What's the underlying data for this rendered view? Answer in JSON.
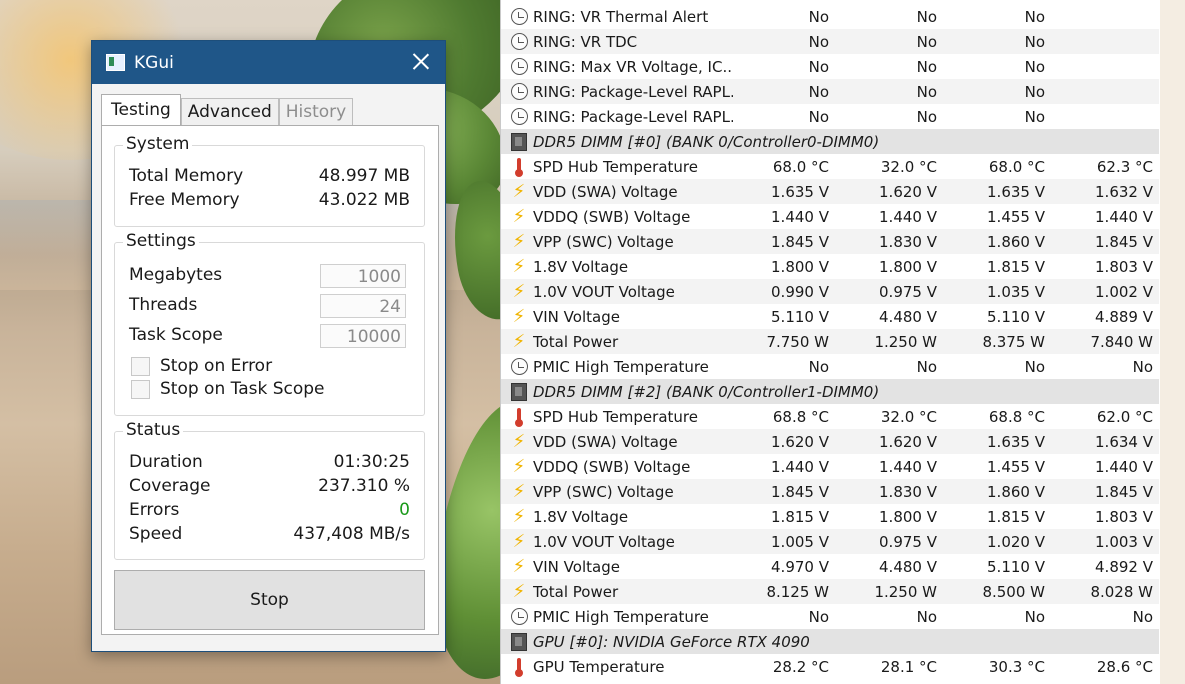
{
  "window": {
    "title": "KGui",
    "icons": {
      "app": "app-icon",
      "close": "close-icon"
    }
  },
  "tabs": [
    {
      "label": "Testing",
      "state": "active"
    },
    {
      "label": "Advanced",
      "state": "normal"
    },
    {
      "label": "History",
      "state": "disabled"
    }
  ],
  "system": {
    "title": "System",
    "total_memory_label": "Total Memory",
    "total_memory_value": "48.997 MB",
    "free_memory_label": "Free Memory",
    "free_memory_value": "43.022 MB"
  },
  "settings": {
    "title": "Settings",
    "megabytes_label": "Megabytes",
    "megabytes_value": "1000",
    "threads_label": "Threads",
    "threads_value": "24",
    "task_scope_label": "Task Scope",
    "task_scope_value": "10000",
    "stop_on_error_label": "Stop on Error",
    "stop_on_task_scope_label": "Stop on Task Scope"
  },
  "status": {
    "title": "Status",
    "duration_label": "Duration",
    "duration_value": "01:30:25",
    "coverage_label": "Coverage",
    "coverage_value": "237.310 %",
    "errors_label": "Errors",
    "errors_value": "0",
    "speed_label": "Speed",
    "speed_value": "437,408 MB/s"
  },
  "stop_button": {
    "label": "Stop"
  },
  "colors": {
    "titlebar": "#1f5688",
    "errors_ok": "#1a9a1a",
    "bolt": "#f0b400",
    "thermometer": "#d23d2d"
  },
  "sensors": {
    "rows": [
      {
        "kind": "clock",
        "name": "RING: VR Thermal Alert",
        "c1": "No",
        "c2": "No",
        "c3": "No",
        "c4": ""
      },
      {
        "kind": "clock",
        "name": "RING: VR TDC",
        "c1": "No",
        "c2": "No",
        "c3": "No",
        "c4": ""
      },
      {
        "kind": "clock",
        "name": "RING: Max VR Voltage, IC...",
        "c1": "No",
        "c2": "No",
        "c3": "No",
        "c4": ""
      },
      {
        "kind": "clock",
        "name": "RING: Package-Level RAPL...",
        "c1": "No",
        "c2": "No",
        "c3": "No",
        "c4": ""
      },
      {
        "kind": "clock",
        "name": "RING: Package-Level RAPL...",
        "c1": "No",
        "c2": "No",
        "c3": "No",
        "c4": ""
      },
      {
        "kind": "header",
        "name": "DDR5 DIMM [#0] (BANK 0/Controller0-DIMM0)"
      },
      {
        "kind": "therm",
        "name": "SPD Hub Temperature",
        "c1": "68.0 °C",
        "c2": "32.0 °C",
        "c3": "68.0 °C",
        "c4": "62.3 °C"
      },
      {
        "kind": "bolt",
        "name": "VDD (SWA) Voltage",
        "c1": "1.635 V",
        "c2": "1.620 V",
        "c3": "1.635 V",
        "c4": "1.632 V"
      },
      {
        "kind": "bolt",
        "name": "VDDQ (SWB) Voltage",
        "c1": "1.440 V",
        "c2": "1.440 V",
        "c3": "1.455 V",
        "c4": "1.440 V"
      },
      {
        "kind": "bolt",
        "name": "VPP (SWC) Voltage",
        "c1": "1.845 V",
        "c2": "1.830 V",
        "c3": "1.860 V",
        "c4": "1.845 V"
      },
      {
        "kind": "bolt",
        "name": "1.8V Voltage",
        "c1": "1.800 V",
        "c2": "1.800 V",
        "c3": "1.815 V",
        "c4": "1.803 V"
      },
      {
        "kind": "bolt",
        "name": "1.0V VOUT Voltage",
        "c1": "0.990 V",
        "c2": "0.975 V",
        "c3": "1.035 V",
        "c4": "1.002 V"
      },
      {
        "kind": "bolt",
        "name": "VIN Voltage",
        "c1": "5.110 V",
        "c2": "4.480 V",
        "c3": "5.110 V",
        "c4": "4.889 V"
      },
      {
        "kind": "bolt",
        "name": "Total Power",
        "c1": "7.750 W",
        "c2": "1.250 W",
        "c3": "8.375 W",
        "c4": "7.840 W"
      },
      {
        "kind": "clock",
        "name": "PMIC High Temperature",
        "c1": "No",
        "c2": "No",
        "c3": "No",
        "c4": "No"
      },
      {
        "kind": "header",
        "name": "DDR5 DIMM [#2] (BANK 0/Controller1-DIMM0)"
      },
      {
        "kind": "therm",
        "name": "SPD Hub Temperature",
        "c1": "68.8 °C",
        "c2": "32.0 °C",
        "c3": "68.8 °C",
        "c4": "62.0 °C"
      },
      {
        "kind": "bolt",
        "name": "VDD (SWA) Voltage",
        "c1": "1.620 V",
        "c2": "1.620 V",
        "c3": "1.635 V",
        "c4": "1.634 V"
      },
      {
        "kind": "bolt",
        "name": "VDDQ (SWB) Voltage",
        "c1": "1.440 V",
        "c2": "1.440 V",
        "c3": "1.455 V",
        "c4": "1.440 V"
      },
      {
        "kind": "bolt",
        "name": "VPP (SWC) Voltage",
        "c1": "1.845 V",
        "c2": "1.830 V",
        "c3": "1.860 V",
        "c4": "1.845 V"
      },
      {
        "kind": "bolt",
        "name": "1.8V Voltage",
        "c1": "1.815 V",
        "c2": "1.800 V",
        "c3": "1.815 V",
        "c4": "1.803 V"
      },
      {
        "kind": "bolt",
        "name": "1.0V VOUT Voltage",
        "c1": "1.005 V",
        "c2": "0.975 V",
        "c3": "1.020 V",
        "c4": "1.003 V"
      },
      {
        "kind": "bolt",
        "name": "VIN Voltage",
        "c1": "4.970 V",
        "c2": "4.480 V",
        "c3": "5.110 V",
        "c4": "4.892 V"
      },
      {
        "kind": "bolt",
        "name": "Total Power",
        "c1": "8.125 W",
        "c2": "1.250 W",
        "c3": "8.500 W",
        "c4": "8.028 W"
      },
      {
        "kind": "clock",
        "name": "PMIC High Temperature",
        "c1": "No",
        "c2": "No",
        "c3": "No",
        "c4": "No"
      },
      {
        "kind": "header",
        "name": "GPU [#0]: NVIDIA GeForce RTX 4090"
      },
      {
        "kind": "therm",
        "name": "GPU Temperature",
        "c1": "28.2 °C",
        "c2": "28.1 °C",
        "c3": "30.3 °C",
        "c4": "28.6 °C"
      }
    ]
  }
}
